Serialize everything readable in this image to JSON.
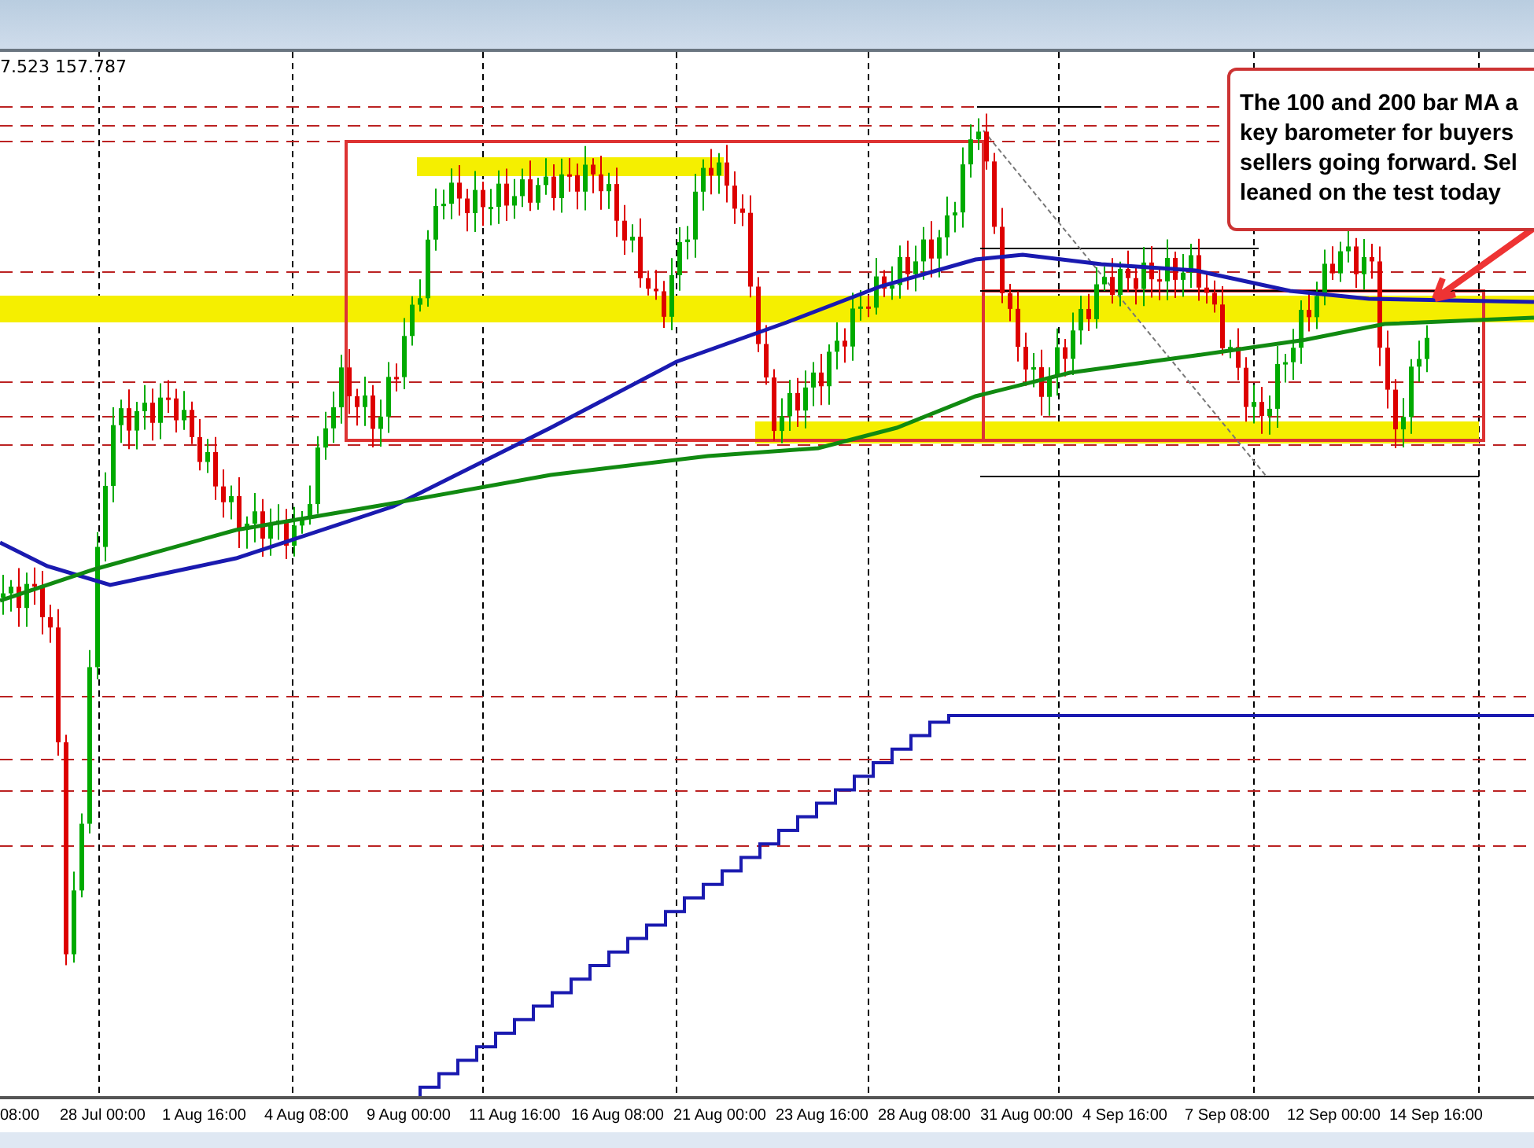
{
  "chart_header": {
    "price_readout": "7.523 157.787"
  },
  "annotation": {
    "lines": [
      "The 100 and 200 bar MA a",
      "key barometer for buyers",
      "sellers going forward. Sel",
      "leaned on the test today"
    ]
  },
  "x_axis": {
    "labels": [
      "08:00",
      "28 Jul 00:00",
      "1 Aug 16:00",
      "4 Aug 08:00",
      "9 Aug 00:00",
      "11 Aug 16:00",
      "16 Aug 08:00",
      "21 Aug 00:00",
      "23 Aug 16:00",
      "28 Aug 08:00",
      "31 Aug 00:00",
      "4 Sep 16:00",
      "7 Sep 08:00",
      "12 Sep 00:00",
      "14 Sep 16:00"
    ]
  }
}
